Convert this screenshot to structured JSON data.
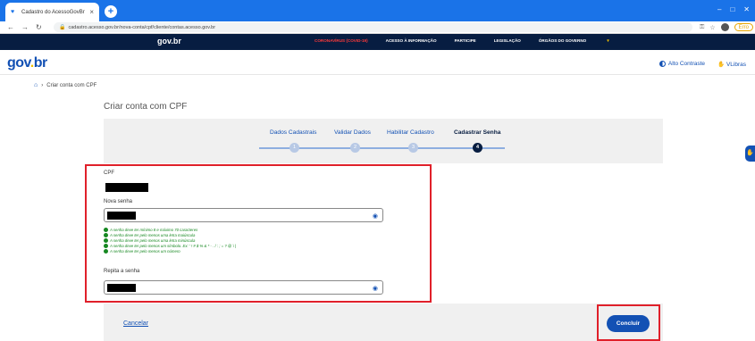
{
  "browser": {
    "tab_title": "Cadastro do AcessoGovBr",
    "tab_close": "×",
    "new_tab": "+",
    "url": "cadastro.acesso.gov.br/nova-conta/cpf/cliente/contas.acesso.gov.br",
    "profile": "Erro"
  },
  "gov_bar": {
    "logo": "gov.br",
    "links": [
      "CORONAVÍRUS (COVID-19)",
      "ACESSO À INFORMAÇÃO",
      "PARTICIPE",
      "LEGISLAÇÃO",
      "ÓRGÃOS DO GOVERNO"
    ]
  },
  "header": {
    "logo_gov": "gov",
    "logo_dot": ".",
    "logo_br": "br",
    "contrast": "Alto Contraste",
    "vlibras": "VLibras"
  },
  "breadcrumb": {
    "current": "Criar conta com CPF"
  },
  "page": {
    "title": "Criar conta com CPF"
  },
  "stepper": {
    "steps": [
      {
        "label": "Dados Cadastrais",
        "num": "1"
      },
      {
        "label": "Validar Dados",
        "num": "2"
      },
      {
        "label": "Habilitar Cadastro",
        "num": "3"
      },
      {
        "label": "Cadastrar Senha",
        "num": "4"
      }
    ]
  },
  "form": {
    "cpf_label": "CPF",
    "new_password_label": "Nova senha",
    "repeat_password_label": "Repita a senha",
    "rules": [
      "A senha deve ter mínimo 8 e máximo 70 caracteres",
      "A senha deve ter pelo menos uma letra maiúscula",
      "A senha deve ter pelo menos uma letra minúscula",
      "A senha deve ter pelo menos um símbolo. Ex: ' ! # $ % & * - . / : ; = ? @ \\ |",
      "A senha deve ter pelo menos um número"
    ]
  },
  "actions": {
    "cancel": "Cancelar",
    "conclude": "Concluir"
  },
  "colors": {
    "primary": "#1351b4",
    "gov_bar": "#071d41",
    "highlight": "#e0202a",
    "success": "#168821"
  }
}
